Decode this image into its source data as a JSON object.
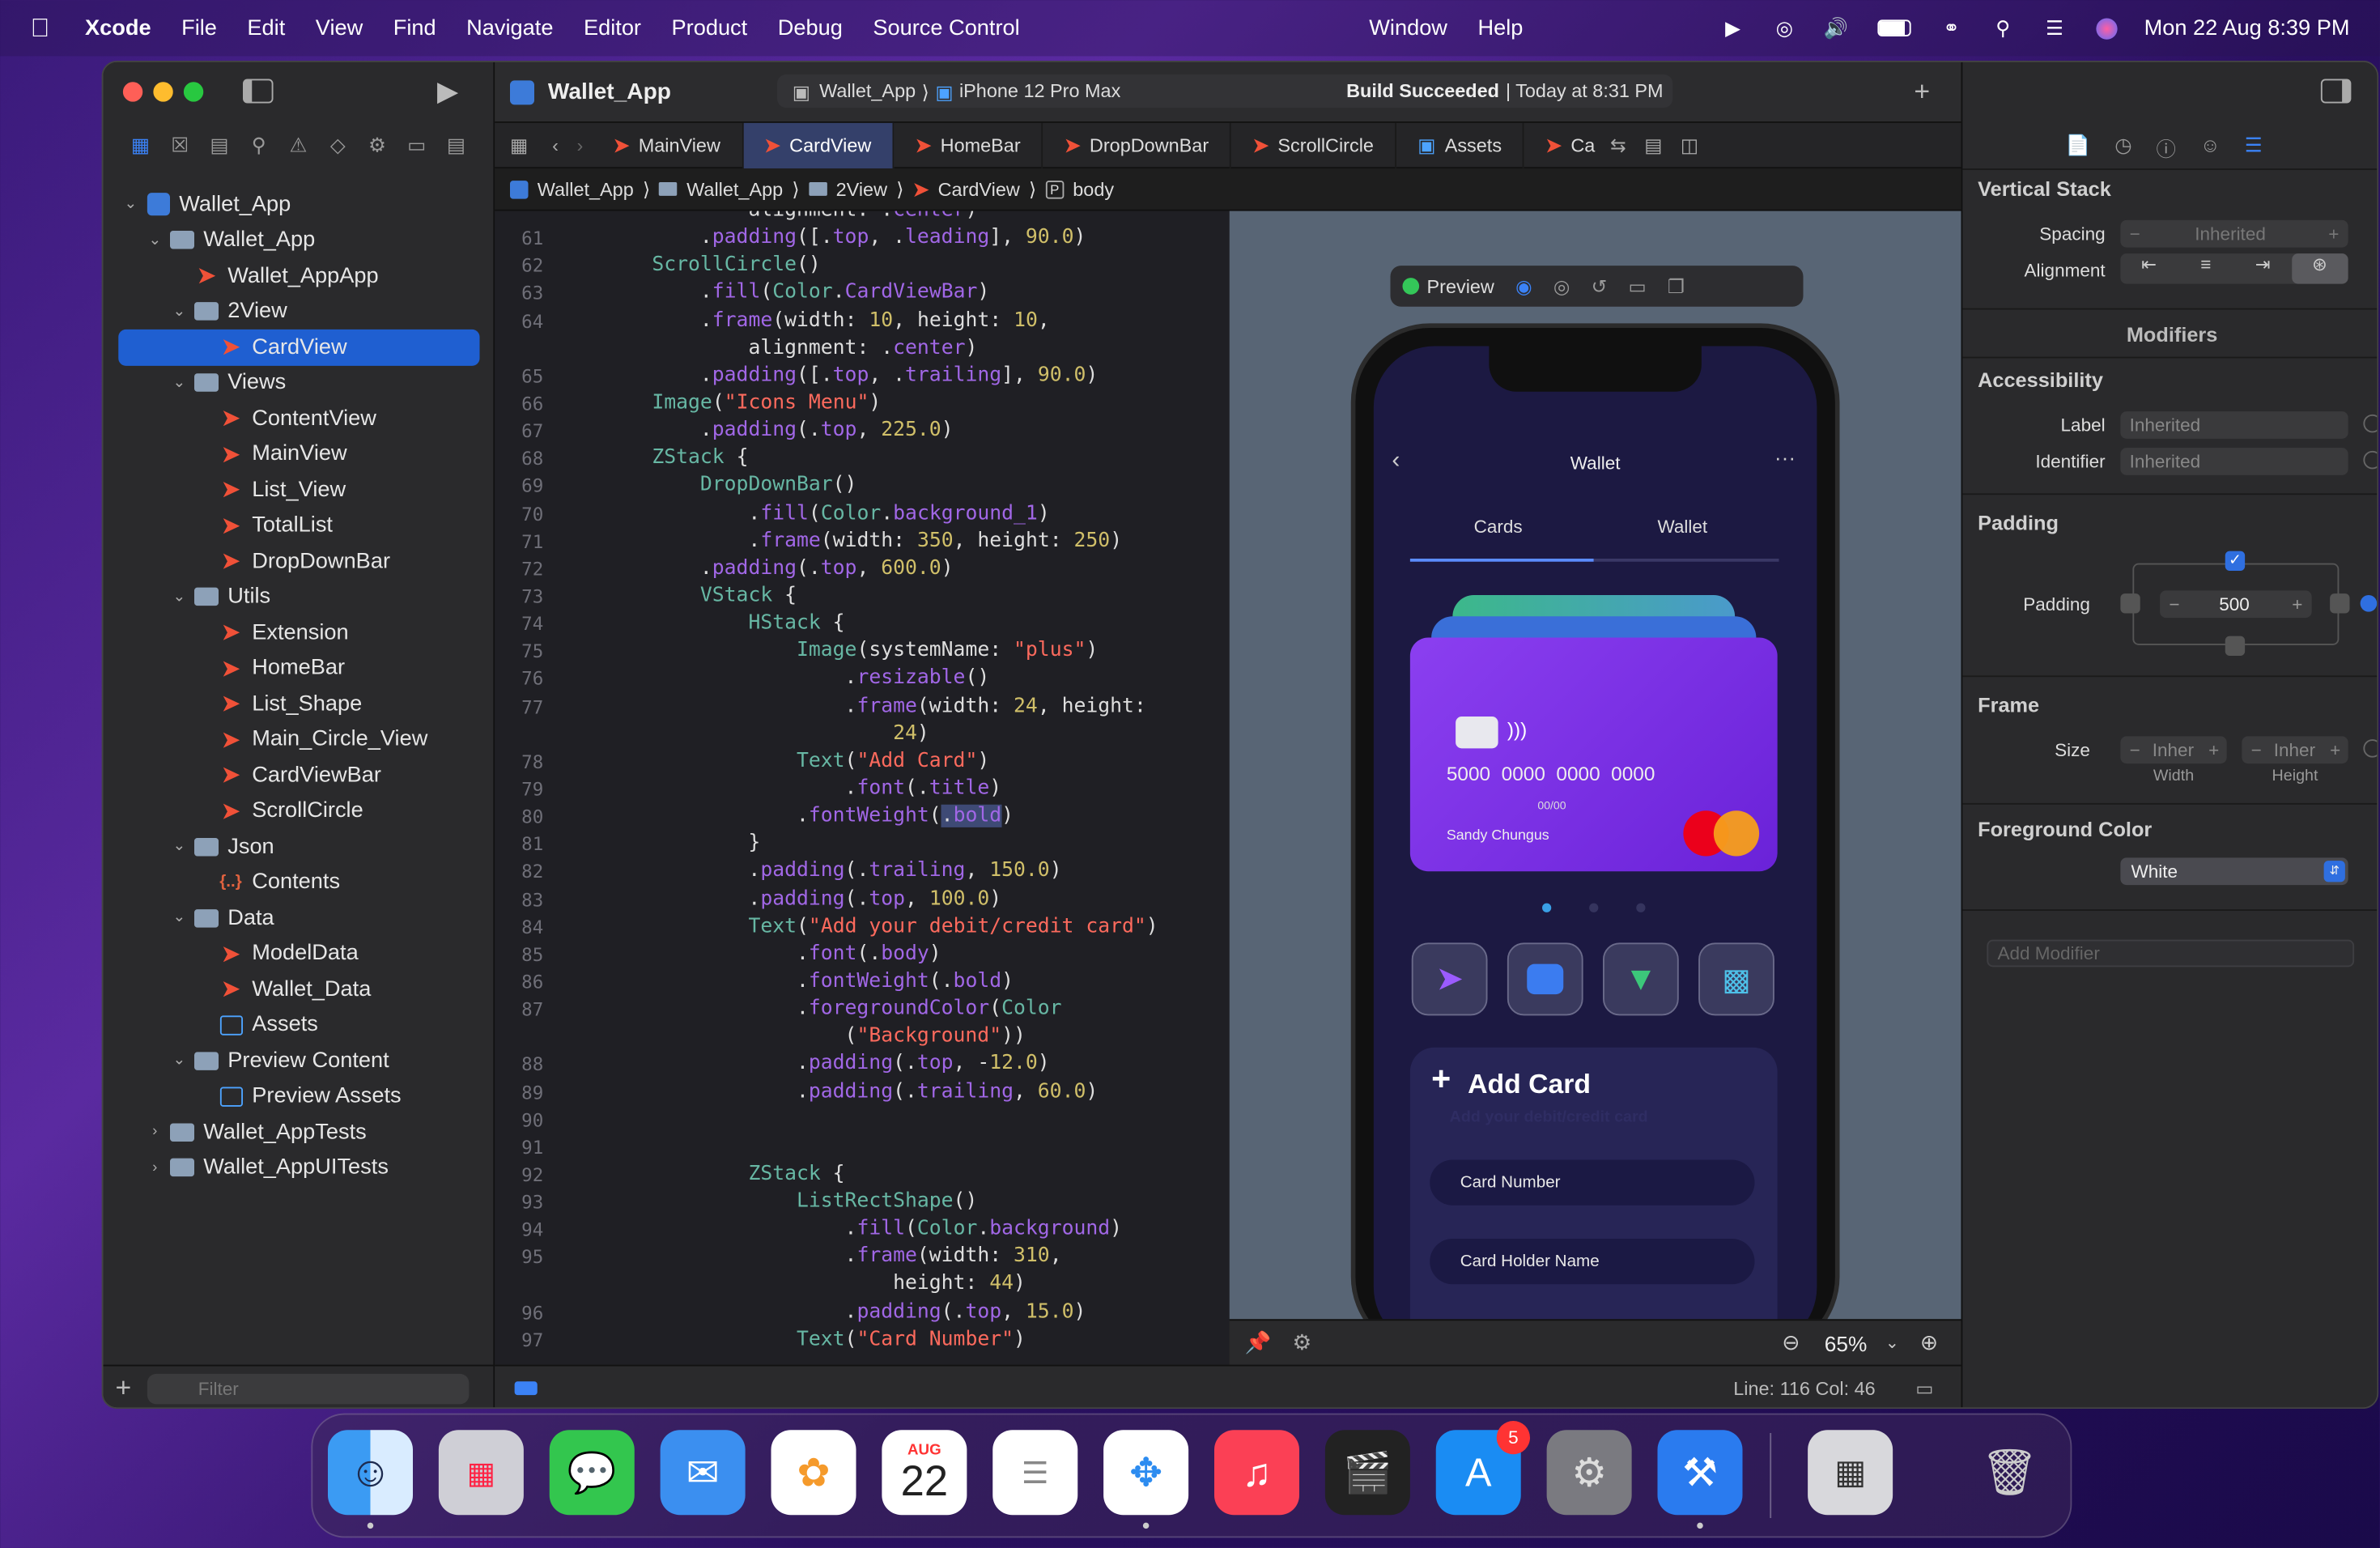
{
  "menubar": {
    "app": "Xcode",
    "items": [
      "File",
      "Edit",
      "View",
      "Find",
      "Navigate",
      "Editor",
      "Product",
      "Debug",
      "Source Control"
    ],
    "right_items": [
      "Window",
      "Help"
    ],
    "datetime": "Mon 22 Aug  8:39 PM"
  },
  "window": {
    "project": "Wallet_App",
    "scheme": "Wallet_App",
    "device": "iPhone 12 Pro Max",
    "build_status_bold": "Build Succeeded",
    "build_status_time": "| Today at 8:31 PM"
  },
  "tabs": [
    "MainView",
    "CardView",
    "HomeBar",
    "DropDownBar",
    "ScrollCircle",
    "Assets",
    "Ca"
  ],
  "active_tab": "CardView",
  "jumpbar": [
    "Wallet_App",
    "Wallet_App",
    "2View",
    "CardView",
    "body"
  ],
  "navigator": [
    {
      "label": "Wallet_App",
      "depth": 0,
      "kind": "project",
      "open": true
    },
    {
      "label": "Wallet_App",
      "depth": 1,
      "kind": "folder",
      "open": true
    },
    {
      "label": "Wallet_AppApp",
      "depth": 2,
      "kind": "swift"
    },
    {
      "label": "2View",
      "depth": 2,
      "kind": "folder",
      "open": true
    },
    {
      "label": "CardView",
      "depth": 3,
      "kind": "swift",
      "selected": true
    },
    {
      "label": "Views",
      "depth": 2,
      "kind": "folder",
      "open": true
    },
    {
      "label": "ContentView",
      "depth": 3,
      "kind": "swift"
    },
    {
      "label": "MainView",
      "depth": 3,
      "kind": "swift"
    },
    {
      "label": "List_View",
      "depth": 3,
      "kind": "swift"
    },
    {
      "label": "TotalList",
      "depth": 3,
      "kind": "swift"
    },
    {
      "label": "DropDownBar",
      "depth": 3,
      "kind": "swift"
    },
    {
      "label": "Utils",
      "depth": 2,
      "kind": "folder",
      "open": true
    },
    {
      "label": "Extension",
      "depth": 3,
      "kind": "swift"
    },
    {
      "label": "HomeBar",
      "depth": 3,
      "kind": "swift"
    },
    {
      "label": "List_Shape",
      "depth": 3,
      "kind": "swift"
    },
    {
      "label": "Main_Circle_View",
      "depth": 3,
      "kind": "swift"
    },
    {
      "label": "CardViewBar",
      "depth": 3,
      "kind": "swift"
    },
    {
      "label": "ScrollCircle",
      "depth": 3,
      "kind": "swift"
    },
    {
      "label": "Json",
      "depth": 2,
      "kind": "folder",
      "open": true
    },
    {
      "label": "Contents",
      "depth": 3,
      "kind": "json"
    },
    {
      "label": "Data",
      "depth": 2,
      "kind": "folder",
      "open": true
    },
    {
      "label": "ModelData",
      "depth": 3,
      "kind": "swift"
    },
    {
      "label": "Wallet_Data",
      "depth": 3,
      "kind": "swift"
    },
    {
      "label": "Assets",
      "depth": 3,
      "kind": "assets"
    },
    {
      "label": "Preview Content",
      "depth": 2,
      "kind": "folder",
      "open": true
    },
    {
      "label": "Preview Assets",
      "depth": 3,
      "kind": "assets"
    },
    {
      "label": "Wallet_AppTests",
      "depth": 1,
      "kind": "folder",
      "open": false
    },
    {
      "label": "Wallet_AppUITests",
      "depth": 1,
      "kind": "folder",
      "open": false
    }
  ],
  "filter_placeholder": "Filter",
  "code_lines": [
    {
      "n": "",
      "t": "                alignment: .center)"
    },
    {
      "n": "61",
      "t": "            .padding([.top, .leading], 90.0)"
    },
    {
      "n": "62",
      "t": "        ScrollCircle()"
    },
    {
      "n": "63",
      "t": "            .fill(Color.CardViewBar)"
    },
    {
      "n": "64",
      "t": "            .frame(width: 10, height: 10,"
    },
    {
      "n": "",
      "t": "                alignment: .center)"
    },
    {
      "n": "65",
      "t": "            .padding([.top, .trailing], 90.0)"
    },
    {
      "n": "66",
      "t": "        Image(\"Icons Menu\")"
    },
    {
      "n": "67",
      "t": "            .padding(.top, 225.0)"
    },
    {
      "n": "68",
      "t": "        ZStack {"
    },
    {
      "n": "69",
      "t": "            DropDownBar()"
    },
    {
      "n": "70",
      "t": "                .fill(Color.background_1)"
    },
    {
      "n": "71",
      "t": "                .frame(width: 350, height: 250)"
    },
    {
      "n": "72",
      "t": "            .padding(.top, 600.0)"
    },
    {
      "n": "73",
      "t": "            VStack {"
    },
    {
      "n": "74",
      "t": "                HStack {"
    },
    {
      "n": "75",
      "t": "                    Image(systemName: \"plus\")"
    },
    {
      "n": "76",
      "t": "                        .resizable()"
    },
    {
      "n": "77",
      "t": "                        .frame(width: 24, height:"
    },
    {
      "n": "",
      "t": "                            24)"
    },
    {
      "n": "78",
      "t": "                    Text(\"Add Card\")"
    },
    {
      "n": "79",
      "t": "                        .font(.title)"
    },
    {
      "n": "80",
      "t": "                    .fontWeight(.bold)"
    },
    {
      "n": "81",
      "t": "                }"
    },
    {
      "n": "82",
      "t": "                .padding(.trailing, 150.0)"
    },
    {
      "n": "83",
      "t": "                .padding(.top, 100.0)"
    },
    {
      "n": "84",
      "t": "                Text(\"Add your debit/credit card\")"
    },
    {
      "n": "85",
      "t": "                    .font(.body)"
    },
    {
      "n": "86",
      "t": "                    .fontWeight(.bold)"
    },
    {
      "n": "87",
      "t": "                    .foregroundColor(Color"
    },
    {
      "n": "",
      "t": "                        (\"Background\"))"
    },
    {
      "n": "88",
      "t": "                    .padding(.top, -12.0)"
    },
    {
      "n": "89",
      "t": "                    .padding(.trailing, 60.0)"
    },
    {
      "n": "90",
      "t": ""
    },
    {
      "n": "91",
      "t": ""
    },
    {
      "n": "92",
      "t": "                ZStack {"
    },
    {
      "n": "93",
      "t": "                    ListRectShape()"
    },
    {
      "n": "94",
      "t": "                        .fill(Color.background)"
    },
    {
      "n": "95",
      "t": "                        .frame(width: 310,"
    },
    {
      "n": "",
      "t": "                            height: 44)"
    },
    {
      "n": "96",
      "t": "                        .padding(.top, 15.0)"
    },
    {
      "n": "97",
      "t": "                    Text(\"Card Number\")"
    }
  ],
  "preview": {
    "button": "Preview",
    "zoom": "65%",
    "phone": {
      "title": "Wallet",
      "tab_cards": "Cards",
      "tab_wallet": "Wallet",
      "card_number": "5000  0000  0000  0000",
      "card_expiry": "00/00",
      "card_holder": "Sandy Chungus",
      "add_card": "Add Card",
      "add_card_sub": "Add your debit/credit card",
      "field1": "Card Number",
      "field2": "Card Holder Name"
    }
  },
  "status": {
    "position": "Line: 116  Col: 46"
  },
  "inspector": {
    "section": "Vertical Stack",
    "spacing_label": "Spacing",
    "spacing_value": "Inherited",
    "alignment_label": "Alignment",
    "modifiers": "Modifiers",
    "accessibility": "Accessibility",
    "label_label": "Label",
    "label_value": "Inherited",
    "identifier_label": "Identifier",
    "identifier_value": "Inherited",
    "padding_header": "Padding",
    "padding_label": "Padding",
    "padding_value": "500",
    "frame_header": "Frame",
    "size_label": "Size",
    "width_value": "Inher",
    "height_value": "Inher",
    "width_label": "Width",
    "height_label": "Height",
    "fg_header": "Foreground Color",
    "fg_value": "White",
    "add_modifier": "Add Modifier"
  },
  "dock": {
    "calendar_month": "AUG",
    "calendar_day": "22",
    "appstore_badge": "5"
  }
}
